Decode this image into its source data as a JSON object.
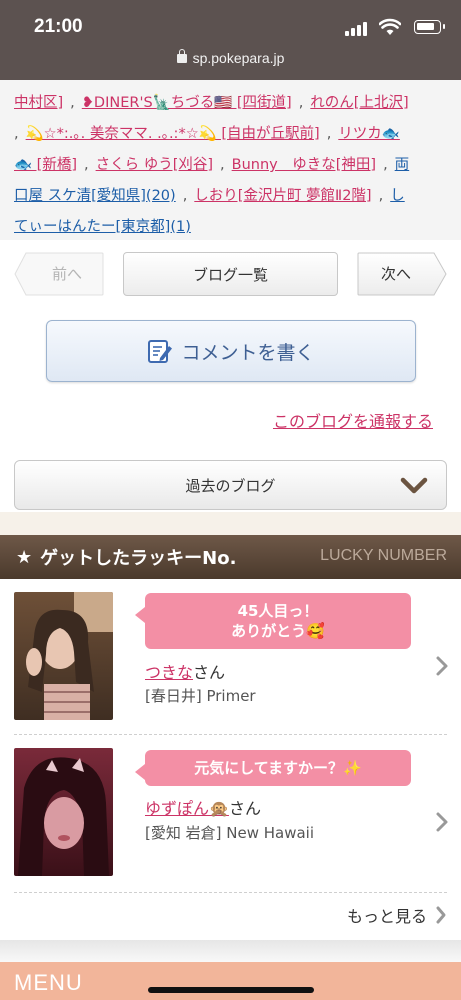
{
  "status": {
    "time": "21:00",
    "url": "sp.pokepara.jp"
  },
  "blog_names": {
    "line1": [
      {
        "text": "中村区]",
        "color": "pink"
      },
      {
        "text": "❥DINER'S🗽ちづる🇺🇸 [四街道]",
        "color": "pink"
      },
      {
        "text": "れのん[上北沢]",
        "color": "pink"
      }
    ],
    "line2": [
      {
        "text": "💫☆*:.｡. 美奈ママ. .｡.:*☆💫 [自由が丘駅前]",
        "color": "pink"
      },
      {
        "text": "リツカ🐟",
        "color": "pink"
      }
    ],
    "line3": [
      {
        "text": "🐟 [新橋]",
        "color": "pink"
      },
      {
        "text": "さくら ゆう[刈谷]",
        "color": "pink"
      },
      {
        "text": "Bunny　ゆきな[神田]",
        "color": "pink"
      },
      {
        "text": "両",
        "color": "blue"
      }
    ],
    "line4": [
      {
        "text": "口屋 スケ清[愛知県](20)",
        "color": "blue"
      },
      {
        "text": "しおり[金沢片町 夢館Ⅱ2階]",
        "color": "pink"
      },
      {
        "text": "し",
        "color": "blue"
      }
    ],
    "line5": [
      {
        "text": "てぃーはんたー[東京都](1)",
        "color": "blue"
      }
    ]
  },
  "pager": {
    "prev": "前へ",
    "list": "ブログ一覧",
    "next": "次へ"
  },
  "comment_button": "コメントを書く",
  "report_link": "このブログを通報する",
  "past_blogs": "過去のブログ",
  "lucky": {
    "title": "ゲットしたラッキーNo.",
    "title_en": "LUCKY NUMBER",
    "items": [
      {
        "message_line1": "45人目っ！",
        "message_line2": "ありがとう🥰",
        "name": "つきな",
        "suffix": "さん",
        "shop": "[春日井] Primer"
      },
      {
        "message_line1": "元気にしてますかー？✨",
        "message_line2": "",
        "name": "ゆずぽん🙊",
        "suffix": "さん",
        "shop": "[愛知 岩倉] New Hawaii"
      }
    ],
    "more": "もっと見る"
  },
  "menu_label": "MENU",
  "colors": {
    "pink_link": "#cc3366",
    "blue_link": "#1d5ea8",
    "header_brown": "#5a4636",
    "bubble_pink": "#f38fa5",
    "menu_bar": "#f2b59a"
  }
}
